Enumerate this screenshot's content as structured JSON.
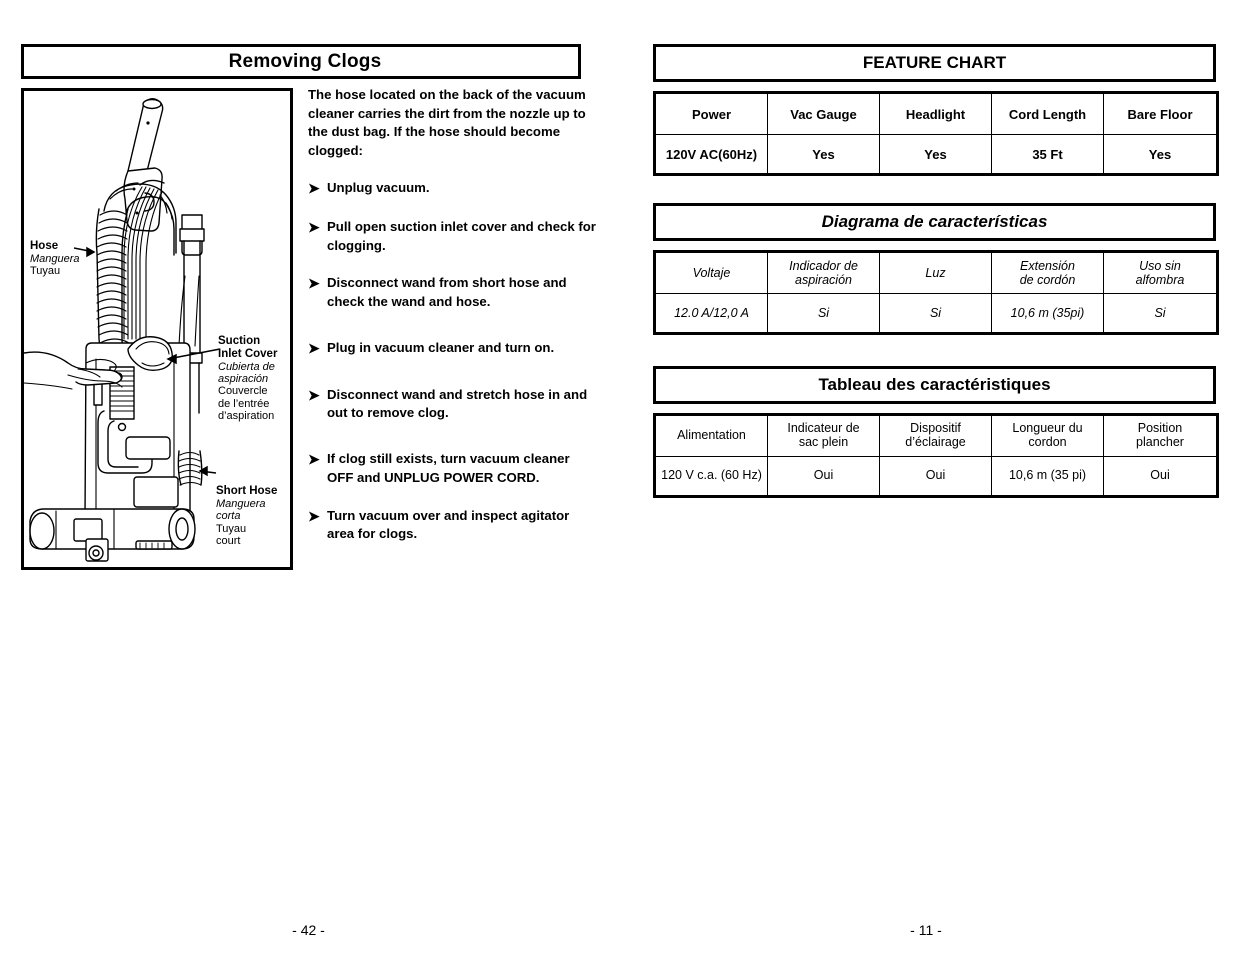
{
  "left_page": {
    "section_title": "Removing Clogs",
    "page_number": "- 42 -",
    "intro_paragraph": "The hose located on the back of the vacuum cleaner carries the dirt from the nozzle up to the dust bag.  If the hose should become clogged:",
    "bullet_glyph": "➤",
    "steps": [
      {
        "text": "Unplug vacuum."
      },
      {
        "text": "Pull open suction inlet cover and check for clogging."
      },
      {
        "text": "Disconnect wand from short hose and check the wand and hose."
      },
      {
        "text": "Plug in vacuum cleaner and turn on."
      },
      {
        "text": "Disconnect wand and stretch hose in and out to remove clog."
      },
      {
        "text": "If clog still exists, turn vacuum cleaner OFF and UNPLUG POWER CORD."
      },
      {
        "text": "Turn vacuum over and inspect agitator area for clogs."
      }
    ],
    "diagram": {
      "alt": "Line drawing of an upright vacuum cleaner with coiled hose, suction inlet cover and short hose",
      "callouts": [
        {
          "en": "Hose",
          "es": "Manguera",
          "fr": "Tuyau"
        },
        {
          "en": "Suction\nInlet Cover",
          "en_line1": "Suction",
          "en_line2": "Inlet Cover",
          "es_line1": "Cubierta de",
          "es_line2": "aspiración",
          "fr_line1": "Couvercle",
          "fr_line2": "de l’entrée",
          "fr_line3": "d’aspiration"
        },
        {
          "en": "Short Hose",
          "es_line1": "Manguera",
          "es_line2": "corta",
          "fr_line1": "Tuyau",
          "fr_line2": "court"
        }
      ]
    }
  },
  "right_page": {
    "page_number": "- 11 -",
    "charts": [
      {
        "id": "chart-en",
        "title": "FEATURE CHART",
        "title_italic": false,
        "headers": [
          "Power",
          "Vac Gauge",
          "Headlight",
          "Cord Length",
          "Bare Floor"
        ],
        "values": [
          "120V AC(60Hz)",
          "Yes",
          "Yes",
          "35 Ft",
          "Yes"
        ]
      },
      {
        "id": "chart-es",
        "title": "Diagrama de características",
        "title_italic": true,
        "headers": [
          "Voltaje",
          "Indicador de aspiración",
          "Luz",
          "Extensión de cordón",
          "Uso sin alfombra"
        ],
        "headers_lines": [
          [
            "Voltaje"
          ],
          [
            "Indicador de",
            "aspiración"
          ],
          [
            "Luz"
          ],
          [
            "Extensión",
            "de cordón"
          ],
          [
            "Uso sin",
            "alfombra"
          ]
        ],
        "values": [
          "12.0 A/12,0 A",
          "Si",
          "Si",
          "10,6 m (35pi)",
          "Si"
        ]
      },
      {
        "id": "chart-fr",
        "title": "Tableau des caractéristiques",
        "title_italic": false,
        "headers": [
          "Alimentation",
          "Indicateur de sac plein",
          "Dispositif d’éclairage",
          "Longueur du cordon",
          "Position plancher"
        ],
        "headers_lines": [
          [
            "Alimentation"
          ],
          [
            "Indicateur de",
            "sac plein"
          ],
          [
            "Dispositif",
            "d’éclairage"
          ],
          [
            "Longueur du",
            "cordon"
          ],
          [
            "Position",
            "plancher"
          ]
        ],
        "values": [
          "120 V c.a. (60 Hz)",
          "Oui",
          "Oui",
          "10,6 m (35 pi)",
          "Oui"
        ]
      }
    ]
  },
  "colors": {
    "ink": "#000000",
    "paper": "#ffffff"
  }
}
